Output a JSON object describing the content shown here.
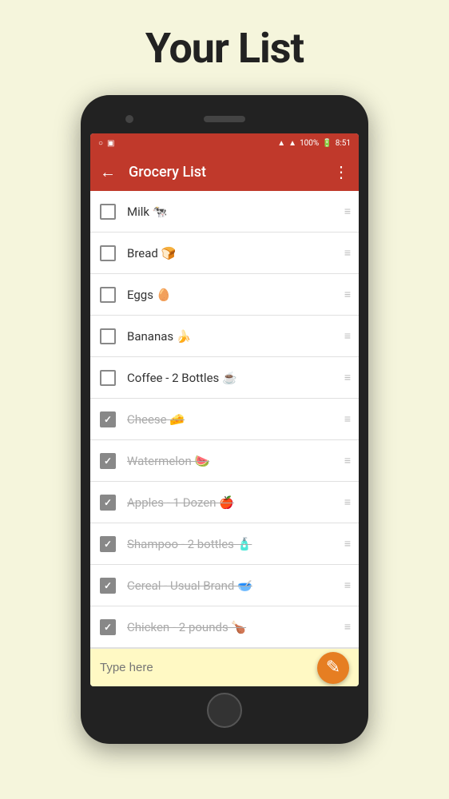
{
  "page": {
    "title": "Your List"
  },
  "toolbar": {
    "back_icon": "←",
    "title": "Grocery List",
    "menu_icon": "⋮"
  },
  "status_bar": {
    "time": "8:51",
    "battery": "100%",
    "icons_left": [
      "○",
      "▣"
    ]
  },
  "list_items": [
    {
      "id": 1,
      "text": "Milk 🐄",
      "checked": false
    },
    {
      "id": 2,
      "text": "Bread 🍞",
      "checked": false
    },
    {
      "id": 3,
      "text": "Eggs 🥚",
      "checked": false
    },
    {
      "id": 4,
      "text": "Bananas 🍌",
      "checked": false
    },
    {
      "id": 5,
      "text": "Coffee - 2 Bottles ☕",
      "checked": false
    },
    {
      "id": 6,
      "text": "Cheese 🧀",
      "checked": true
    },
    {
      "id": 7,
      "text": "Watermelon 🍉",
      "checked": true
    },
    {
      "id": 8,
      "text": "Apples - 1 Dozen 🍎",
      "checked": true
    },
    {
      "id": 9,
      "text": "Shampoo - 2 bottles 🧴",
      "checked": true
    },
    {
      "id": 10,
      "text": "Cereal - Usual Brand 🥣",
      "checked": true
    },
    {
      "id": 11,
      "text": "Chicken - 2 pounds 🍗",
      "checked": true
    }
  ],
  "bottom_bar": {
    "placeholder": "Type here",
    "fab_icon": "✎"
  },
  "drag_icon": "≡"
}
